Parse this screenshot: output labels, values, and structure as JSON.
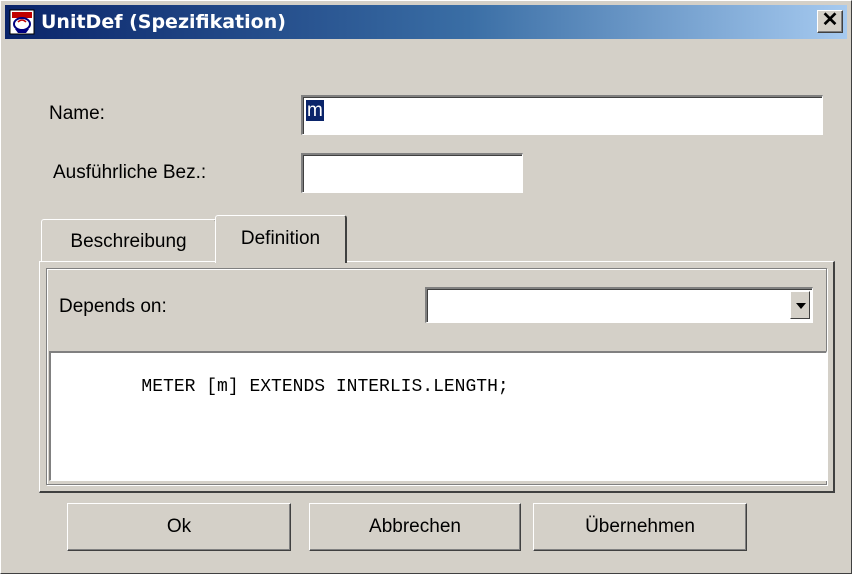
{
  "window": {
    "title": "UnitDef (Spezifikation)",
    "close_label": "✕",
    "icon": "app-icon"
  },
  "form": {
    "name_label": "Name:",
    "name_value": "m",
    "description_label": "Ausführliche Bez.:",
    "description_value": ""
  },
  "tabs": [
    {
      "label": "Beschreibung",
      "active": false
    },
    {
      "label": "Definition",
      "active": true
    }
  ],
  "definition": {
    "depends_label": "Depends on:",
    "depends_value": "",
    "code": "METER [m] EXTENDS INTERLIS.LENGTH;"
  },
  "buttons": {
    "ok": "Ok",
    "cancel": "Abbrechen",
    "apply": "Übernehmen"
  },
  "colors": {
    "title_start": "#0a246a",
    "title_end": "#a6caf0",
    "face": "#d4d0c8"
  }
}
